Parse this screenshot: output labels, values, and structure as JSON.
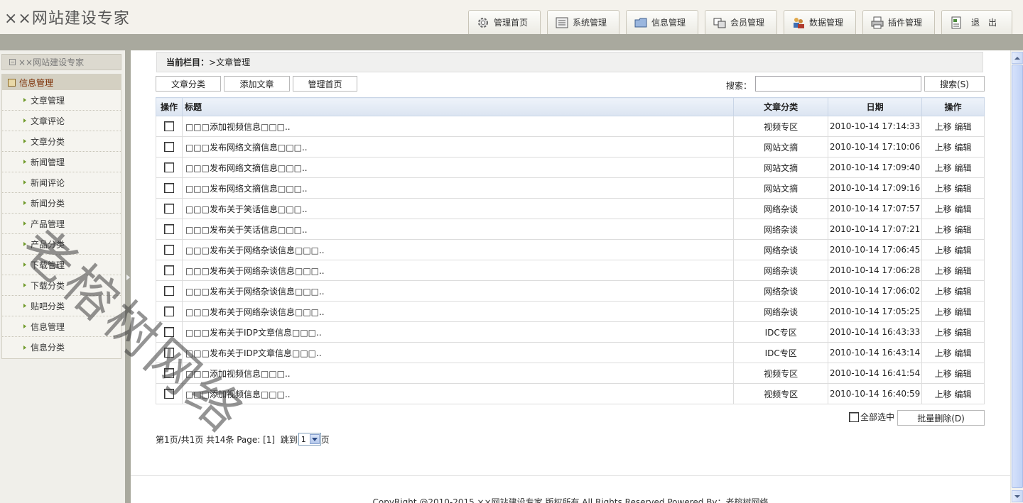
{
  "header": {
    "site_title": "××网站建设专家",
    "nav": [
      {
        "label": "管理首页",
        "icon": "gear-icon"
      },
      {
        "label": "系统管理",
        "icon": "list-icon"
      },
      {
        "label": "信息管理",
        "icon": "folder-icon"
      },
      {
        "label": "会员管理",
        "icon": "window-icon"
      },
      {
        "label": "数据管理",
        "icon": "users-icon"
      },
      {
        "label": "插件管理",
        "icon": "printer-icon"
      },
      {
        "label": "退出",
        "icon": "document-icon"
      }
    ]
  },
  "sidebar": {
    "root_label": "××网站建设专家",
    "group_label": "信息管理",
    "items": [
      "文章管理",
      "文章评论",
      "文章分类",
      "新闻管理",
      "新闻评论",
      "新闻分类",
      "产品管理",
      "产品分类",
      "下载管理",
      "下载分类",
      "贴吧分类",
      "信息管理",
      "信息分类"
    ]
  },
  "main": {
    "crumb_label": "当前栏目：",
    "crumb_value": ">文章管理",
    "btn_category": "文章分类",
    "btn_add": "添加文章",
    "btn_home": "管理首页",
    "search_label": "搜索：",
    "search_value": "",
    "search_button": "搜索(S)",
    "columns": {
      "op": "操作",
      "title": "标题",
      "category": "文章分类",
      "date": "日期",
      "action": "操作"
    },
    "rows": [
      {
        "title": "□□□添加视频信息□□□..",
        "category": "视频专区",
        "date": "2010-10-14 17:14:33",
        "up": "上移",
        "edit": "编辑"
      },
      {
        "title": "□□□发布网络文摘信息□□□..",
        "category": "网站文摘",
        "date": "2010-10-14 17:10:06",
        "up": "上移",
        "edit": "编辑"
      },
      {
        "title": "□□□发布网络文摘信息□□□..",
        "category": "网站文摘",
        "date": "2010-10-14 17:09:40",
        "up": "上移",
        "edit": "编辑"
      },
      {
        "title": "□□□发布网络文摘信息□□□..",
        "category": "网站文摘",
        "date": "2010-10-14 17:09:16",
        "up": "上移",
        "edit": "编辑"
      },
      {
        "title": "□□□发布关于笑话信息□□□..",
        "category": "网络杂谈",
        "date": "2010-10-14 17:07:57",
        "up": "上移",
        "edit": "编辑"
      },
      {
        "title": "□□□发布关于笑话信息□□□..",
        "category": "网络杂谈",
        "date": "2010-10-14 17:07:21",
        "up": "上移",
        "edit": "编辑"
      },
      {
        "title": "□□□发布关于网络杂谈信息□□□..",
        "category": "网络杂谈",
        "date": "2010-10-14 17:06:45",
        "up": "上移",
        "edit": "编辑"
      },
      {
        "title": "□□□发布关于网络杂谈信息□□□..",
        "category": "网络杂谈",
        "date": "2010-10-14 17:06:28",
        "up": "上移",
        "edit": "编辑"
      },
      {
        "title": "□□□发布关于网络杂谈信息□□□..",
        "category": "网络杂谈",
        "date": "2010-10-14 17:06:02",
        "up": "上移",
        "edit": "编辑"
      },
      {
        "title": "□□□发布关于网络杂谈信息□□□..",
        "category": "网络杂谈",
        "date": "2010-10-14 17:05:25",
        "up": "上移",
        "edit": "编辑"
      },
      {
        "title": "□□□发布关于IDP文章信息□□□..",
        "category": "IDC专区",
        "date": "2010-10-14 16:43:33",
        "up": "上移",
        "edit": "编辑"
      },
      {
        "title": "□□□发布关于IDP文章信息□□□..",
        "category": "IDC专区",
        "date": "2010-10-14 16:43:14",
        "up": "上移",
        "edit": "编辑"
      },
      {
        "title": "□□□添加视频信息□□□..",
        "category": "视频专区",
        "date": "2010-10-14 16:41:54",
        "up": "上移",
        "edit": "编辑"
      },
      {
        "title": "□□□添加视频信息□□□..",
        "category": "视频专区",
        "date": "2010-10-14 16:40:59",
        "up": "上移",
        "edit": "编辑"
      }
    ],
    "select_all_label": "全部选中",
    "batch_delete": "批量删除(D)",
    "pager_text": "第1页/共1页 共14条 Page: [1]  跳到",
    "pager_value": "1",
    "pager_suffix": "页",
    "copyright": "CopyRight @2010-2015  ××网站建设专家 版权所有 All Rights Reserved  Powered By：老榕树网络"
  },
  "watermark": "老榕树网络",
  "colors": {
    "header_bg": "#f4f2ec",
    "gray_bar": "#a9a99e",
    "group_title": "#7a2b00",
    "table_header": "#dbe4f1"
  }
}
